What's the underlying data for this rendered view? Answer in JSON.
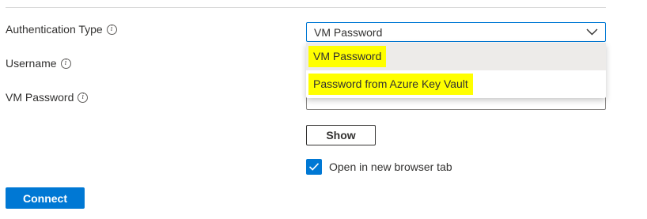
{
  "auth_type": {
    "label": "Authentication Type",
    "info_icon": "info-circle-icon",
    "selected": "VM Password",
    "options": [
      "VM Password",
      "Password from Azure Key Vault"
    ],
    "highlight_color": "#ffff00"
  },
  "username": {
    "label": "Username",
    "info_icon": "info-circle-icon"
  },
  "vm_password": {
    "label": "VM Password",
    "info_icon": "info-circle-icon",
    "value": ""
  },
  "show_button": {
    "label": "Show"
  },
  "open_new_tab": {
    "label": "Open in new browser tab",
    "checked": true
  },
  "connect_button": {
    "label": "Connect"
  },
  "colors": {
    "accent": "#0078d4",
    "text": "#323130",
    "dropdown_selected_bg": "#edebe9"
  }
}
